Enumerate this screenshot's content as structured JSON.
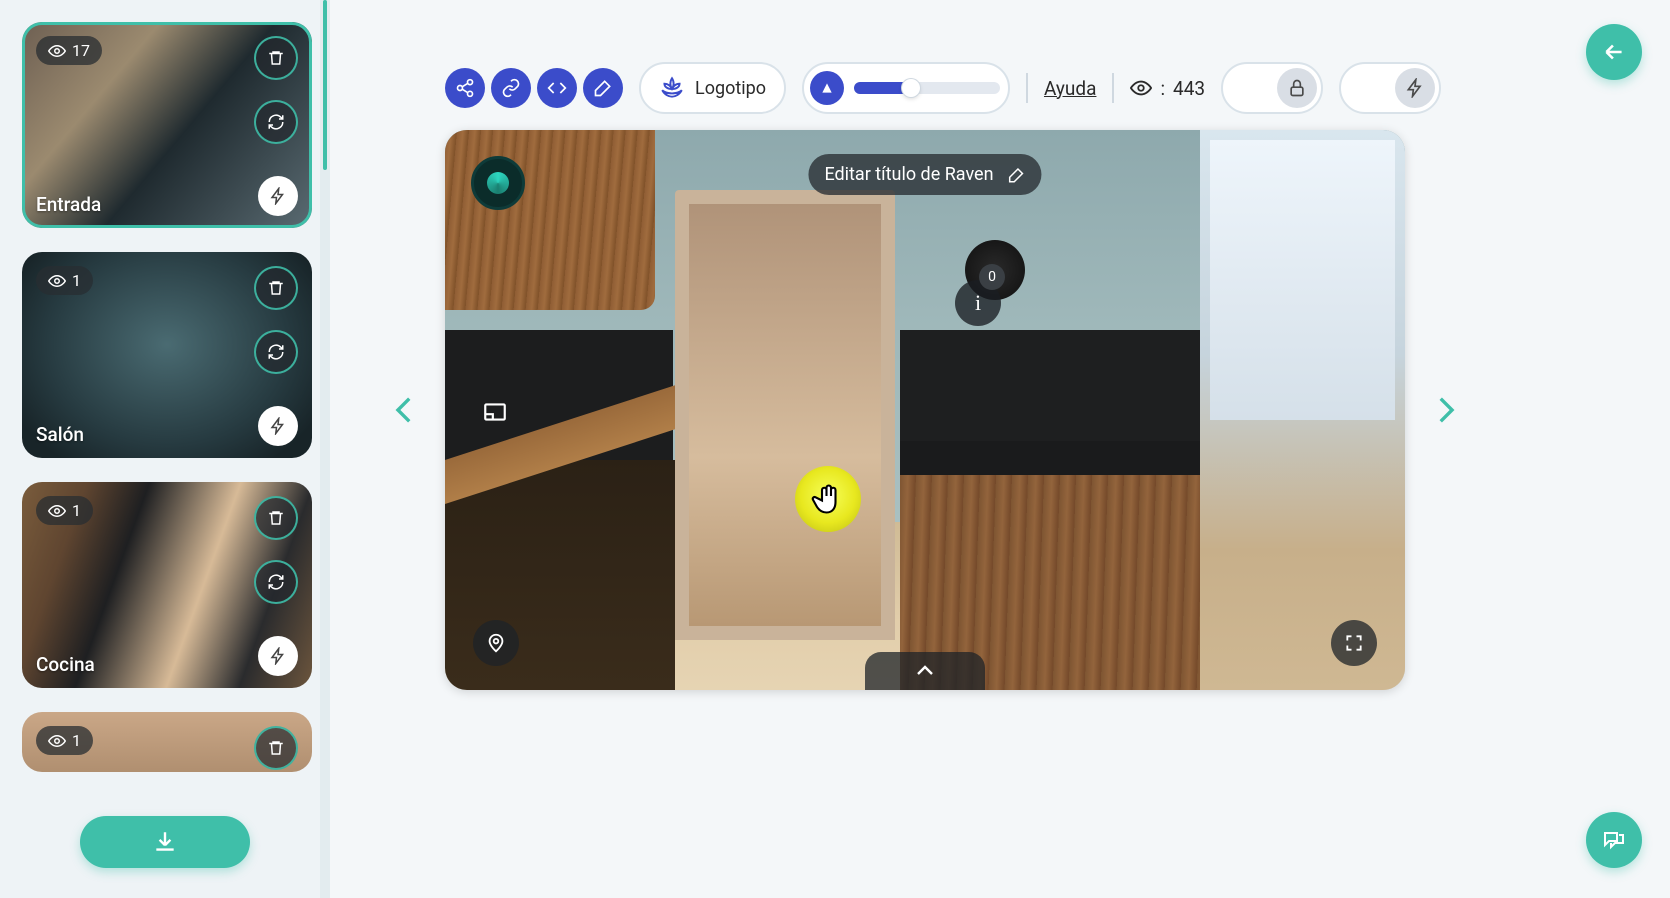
{
  "sidebar": {
    "items": [
      {
        "label": "Entrada",
        "views": "17",
        "selected": true
      },
      {
        "label": "Salón",
        "views": "1",
        "selected": false
      },
      {
        "label": "Cocina",
        "views": "1",
        "selected": false
      },
      {
        "label": "",
        "views": "1",
        "selected": false
      }
    ]
  },
  "toolbar": {
    "logo_label": "Logotipo",
    "help_label": "Ayuda",
    "views_prefix": ":",
    "views_value": "443"
  },
  "viewer": {
    "title": "Editar título de Raven",
    "info_badge": "0",
    "info_char": "i"
  }
}
